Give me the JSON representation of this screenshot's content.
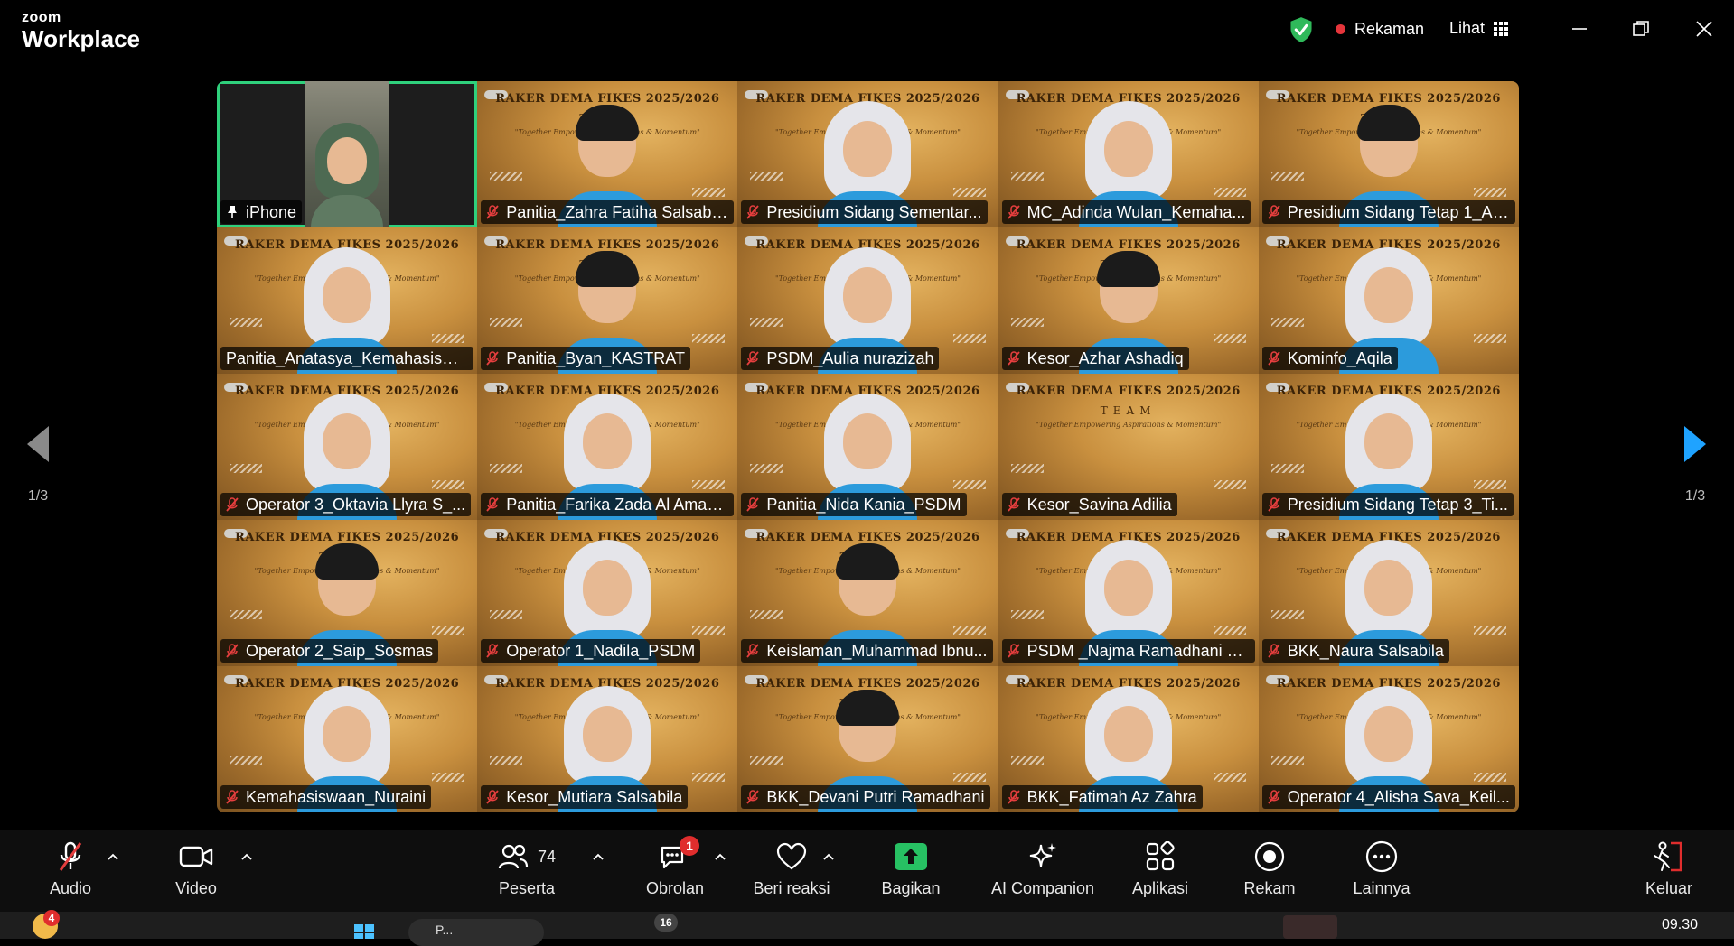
{
  "app": {
    "logo_line1": "zoom",
    "logo_line2": "Workplace"
  },
  "titlebar": {
    "recording_label": "Rekaman",
    "view_label": "Lihat"
  },
  "background_banner": {
    "title": "RAKER DEMA FIKES 2025/2026",
    "team": "TEAM",
    "tagline": "\"Together Empowering Aspirations & Momentum\""
  },
  "participants": [
    {
      "name": "iPhone",
      "muted": false,
      "pinned": true,
      "active": true
    },
    {
      "name": "Panitia_Zahra Fatiha Salsabil...",
      "muted": true
    },
    {
      "name": "Presidium Sidang Sementar...",
      "muted": true
    },
    {
      "name": "MC_Adinda Wulan_Kemaha...",
      "muted": true
    },
    {
      "name": "Presidium Sidang Tetap 1_Ar...",
      "muted": true
    },
    {
      "name": "Panitia_Anatasya_Kemahasiswa...",
      "muted": false
    },
    {
      "name": "Panitia_Byan_KASTRAT",
      "muted": true
    },
    {
      "name": "PSDM_Aulia nurazizah",
      "muted": true
    },
    {
      "name": "Kesor_Azhar Ashadiq",
      "muted": true
    },
    {
      "name": "Kominfo_Aqila",
      "muted": true
    },
    {
      "name": "Operator 3_Oktavia Llyra S_...",
      "muted": true
    },
    {
      "name": "Panitia_Farika Zada Al Amad...",
      "muted": true
    },
    {
      "name": "Panitia_Nida Kania_PSDM",
      "muted": true
    },
    {
      "name": "Kesor_Savina Adilia",
      "muted": true
    },
    {
      "name": "Presidium Sidang Tetap 3_Ti...",
      "muted": true
    },
    {
      "name": "Operator 2_Saip_Sosmas",
      "muted": true
    },
    {
      "name": "Operator 1_Nadila_PSDM",
      "muted": true
    },
    {
      "name": "Keislaman_Muhammad Ibnu...",
      "muted": true
    },
    {
      "name": "PSDM _Najma Ramadhani B...",
      "muted": true
    },
    {
      "name": "BKK_Naura Salsabila",
      "muted": true
    },
    {
      "name": "Kemahasiswaan_Nuraini",
      "muted": true
    },
    {
      "name": "Kesor_Mutiara Salsabila",
      "muted": true
    },
    {
      "name": "BKK_Devani Putri Ramadhani",
      "muted": true
    },
    {
      "name": "BKK_Fatimah Az Zahra",
      "muted": true
    },
    {
      "name": "Operator 4_Alisha Sava_Keil...",
      "muted": true
    }
  ],
  "pager": {
    "left": "1/3",
    "right": "1/3"
  },
  "toolbar": {
    "audio": "Audio",
    "video": "Video",
    "participants": "Peserta",
    "participants_count": "74",
    "chat": "Obrolan",
    "chat_badge": "1",
    "reactions": "Beri reaksi",
    "share": "Bagikan",
    "ai_companion": "AI Companion",
    "apps": "Aplikasi",
    "record": "Rekam",
    "more": "Lainnya",
    "leave": "Keluar"
  },
  "taskbar": {
    "notif_badge": "4",
    "app_badge": "16",
    "search_placeholder": "P...",
    "time": "09.30"
  },
  "colors": {
    "active_speaker_border": "#2fd07c",
    "recording_dot": "#e5353b",
    "shield": "#2fb95a",
    "share_green": "#27c163",
    "leave_red": "#e02d2d"
  }
}
